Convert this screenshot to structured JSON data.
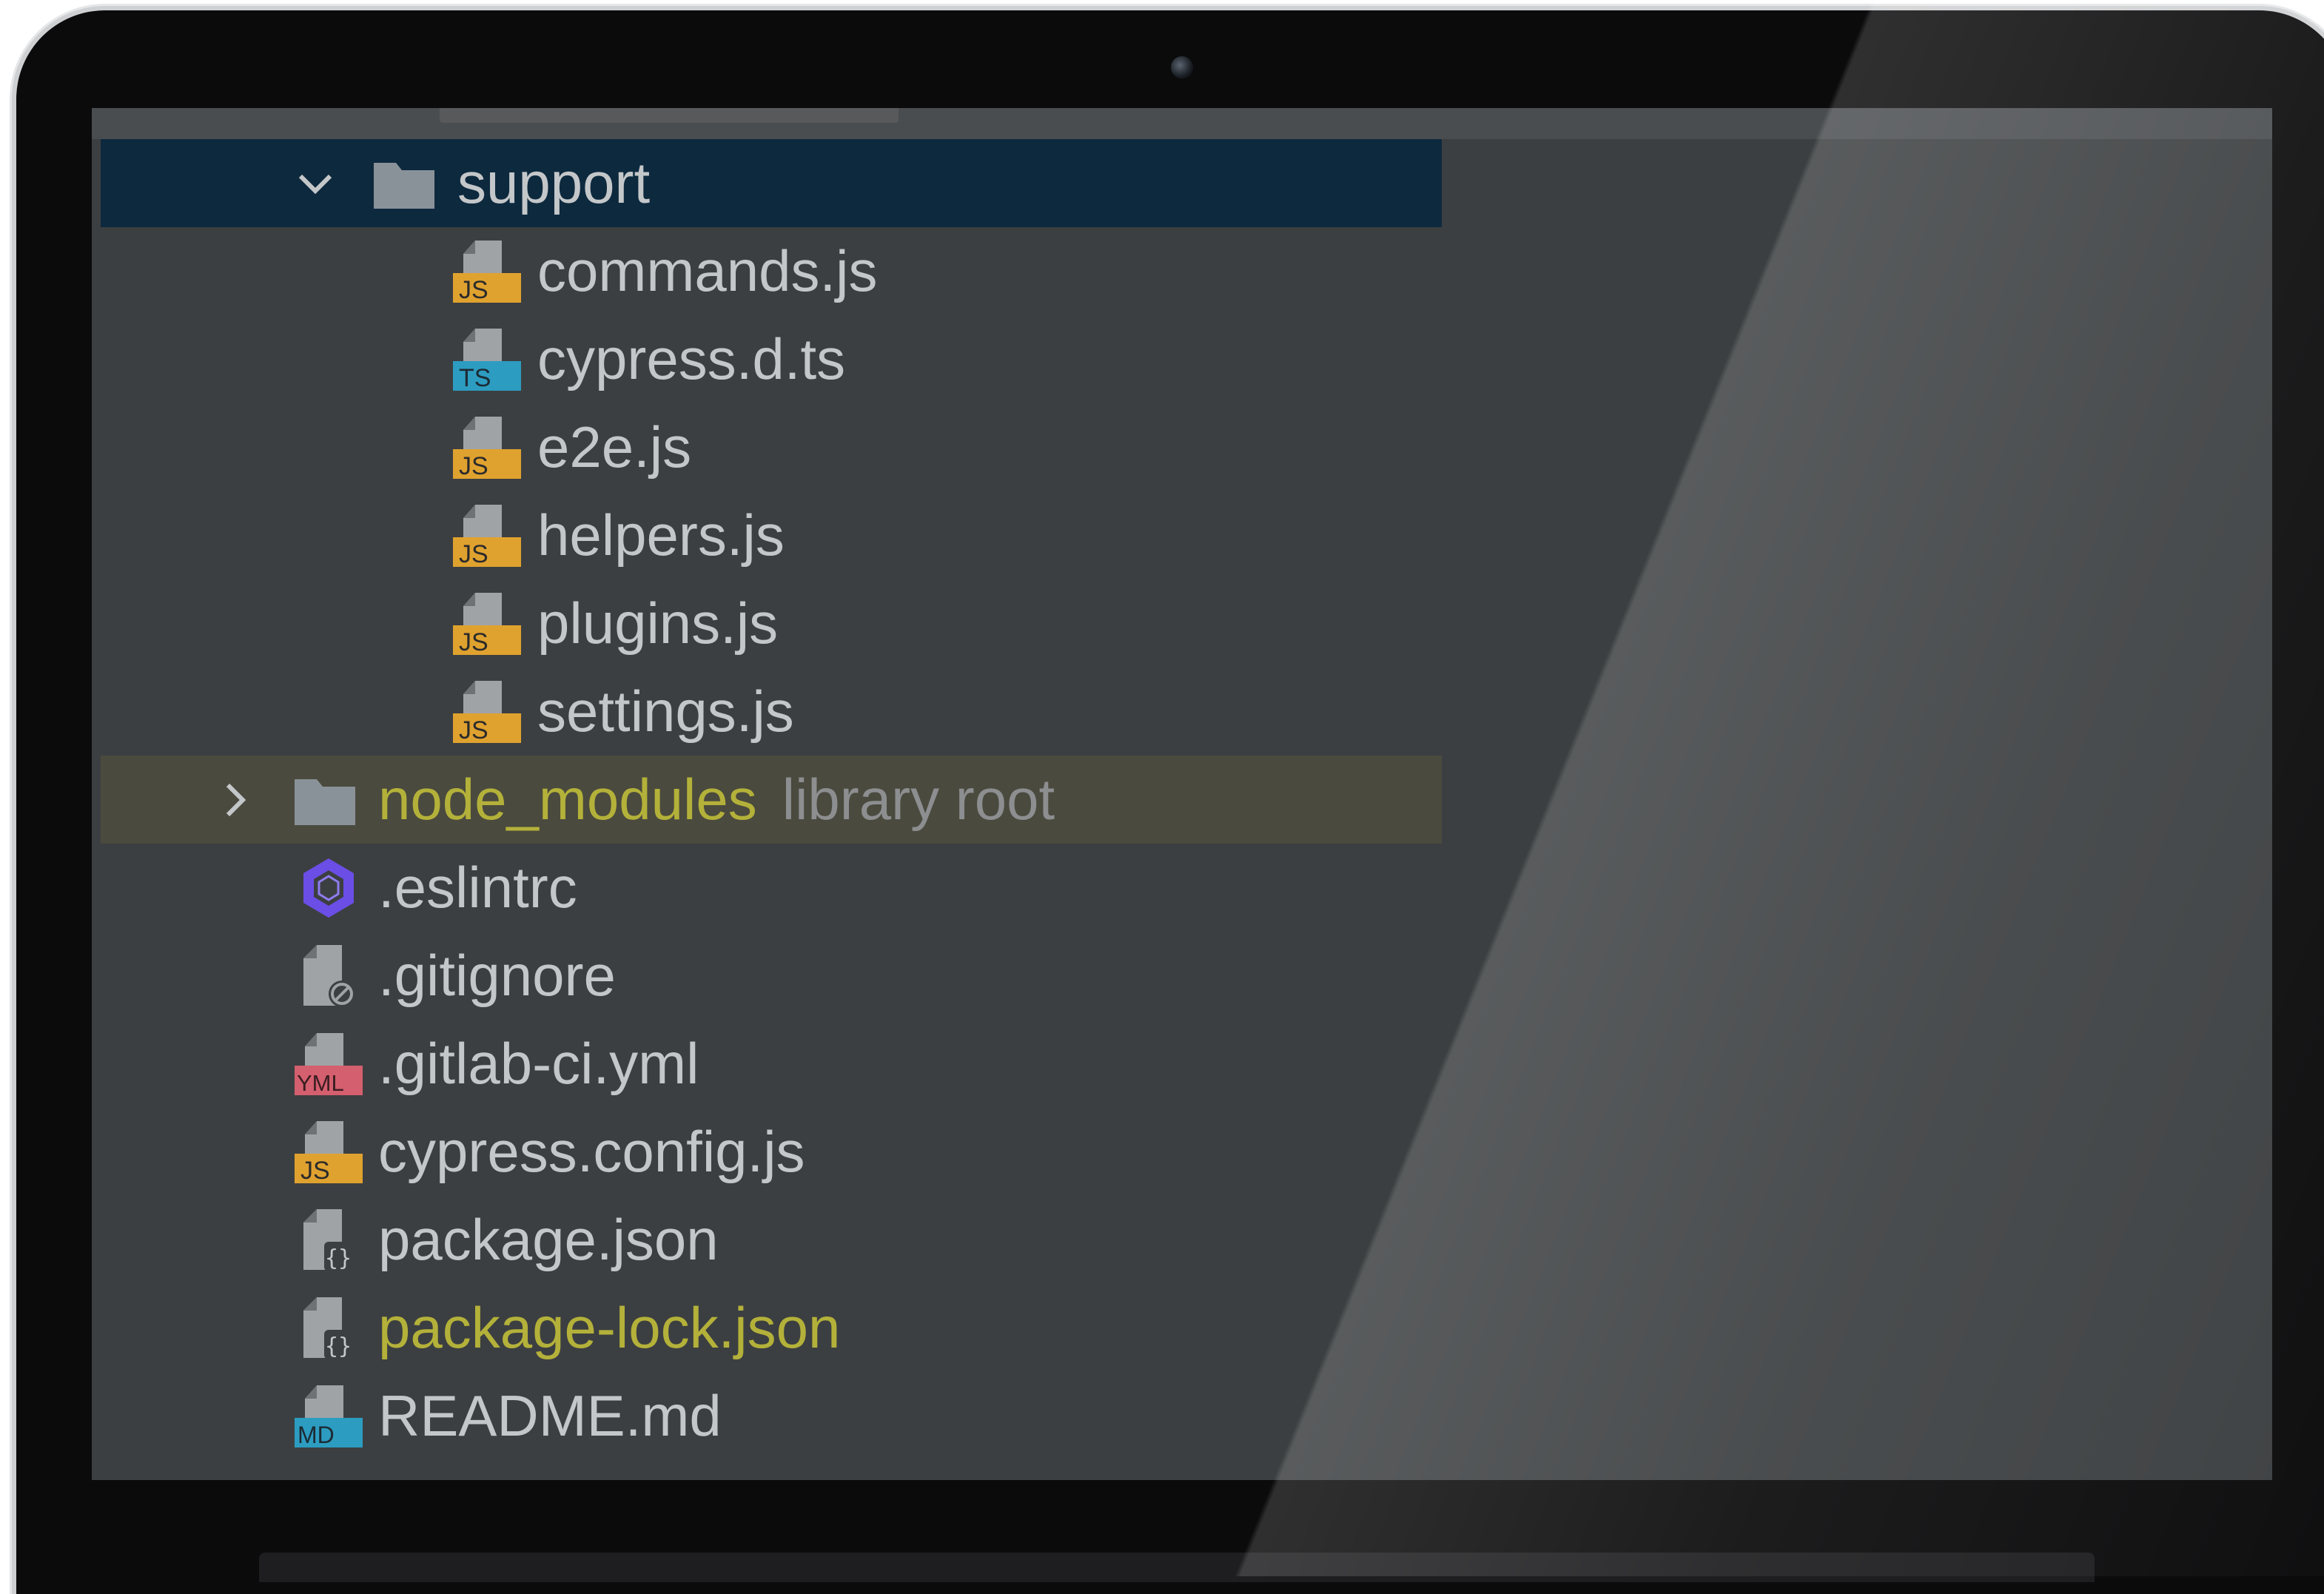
{
  "project_tree": {
    "items": [
      {
        "label": "support",
        "type": "folder",
        "expanded": true,
        "selected": true
      },
      {
        "label": "commands.js",
        "type": "js",
        "badge": "JS"
      },
      {
        "label": "cypress.d.ts",
        "type": "ts",
        "badge": "TS"
      },
      {
        "label": "e2e.js",
        "type": "js",
        "badge": "JS"
      },
      {
        "label": "helpers.js",
        "type": "js",
        "badge": "JS"
      },
      {
        "label": "plugins.js",
        "type": "js",
        "badge": "JS"
      },
      {
        "label": "settings.js",
        "type": "js",
        "badge": "JS"
      },
      {
        "label": "node_modules",
        "hint": "library root",
        "type": "folder",
        "expanded": false,
        "excluded": true
      },
      {
        "label": ".eslintrc",
        "type": "eslint"
      },
      {
        "label": ".gitignore",
        "type": "ignore"
      },
      {
        "label": ".gitlab-ci.yml",
        "type": "yml",
        "badge": "YML"
      },
      {
        "label": "cypress.config.js",
        "type": "js",
        "badge": "JS"
      },
      {
        "label": "package.json",
        "type": "json"
      },
      {
        "label": "package-lock.json",
        "type": "json",
        "highlight": "yellow"
      },
      {
        "label": "README.md",
        "type": "md",
        "badge": "MD"
      }
    ]
  },
  "colors": {
    "panel_bg": "#3c3f41",
    "selection_bg": "#0d293e",
    "excluded_bg": "#4a4a3e",
    "text": "#c4c7c9",
    "library_text": "#b4b13a",
    "js_badge": "#e0a22f",
    "ts_badge": "#2d9cc1",
    "yml_badge": "#d45f6e",
    "md_badge": "#2d9cc1",
    "eslint": "#6b4ee6"
  }
}
